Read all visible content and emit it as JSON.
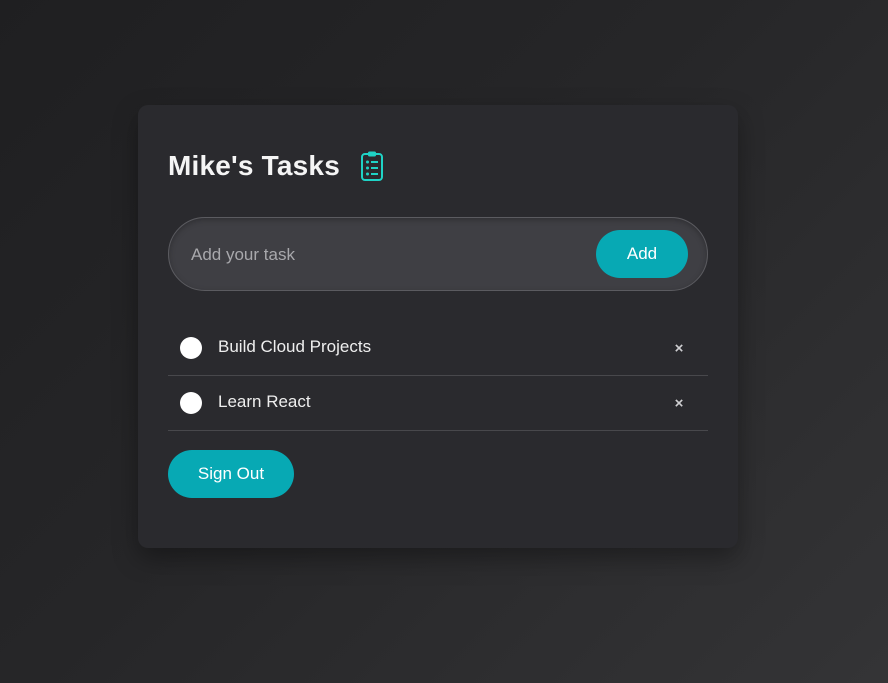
{
  "app": {
    "title": "Mike's Tasks",
    "title_icon": "clipboard-list-icon",
    "accent_color": "#07a9b4"
  },
  "form": {
    "input_value": "",
    "input_placeholder": "Add your task",
    "add_label": "Add"
  },
  "tasks": [
    {
      "label": "Build Cloud Projects",
      "completed": false,
      "delete_label": "×"
    },
    {
      "label": "Learn React",
      "completed": false,
      "delete_label": "×"
    }
  ],
  "signout_label": "Sign Out"
}
